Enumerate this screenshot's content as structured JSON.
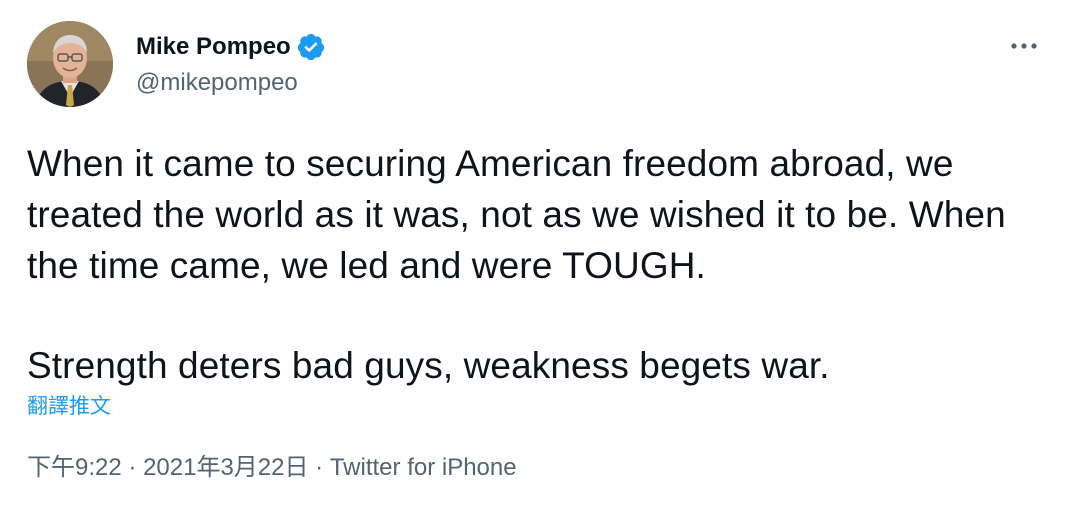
{
  "author": {
    "display_name": "Mike Pompeo",
    "handle": "@mikepompeo",
    "verified": true,
    "avatar_icon": "profile-photo"
  },
  "tweet": {
    "paragraphs": [
      "When it came to securing American freedom abroad, we treated the world as it was, not as we wished it to be. When the time came, we led and were TOUGH.",
      "Strength deters bad guys, weakness begets war."
    ],
    "translate_label": "翻譯推文",
    "time": "下午9:22",
    "separator": "·",
    "date": "2021年3月22日",
    "source": "Twitter for iPhone"
  },
  "icons": {
    "more": "more-horizontal-icon",
    "verified": "verified-badge-icon"
  },
  "colors": {
    "text_primary": "#0f1419",
    "text_secondary": "#536471",
    "accent": "#1d9bf0"
  }
}
